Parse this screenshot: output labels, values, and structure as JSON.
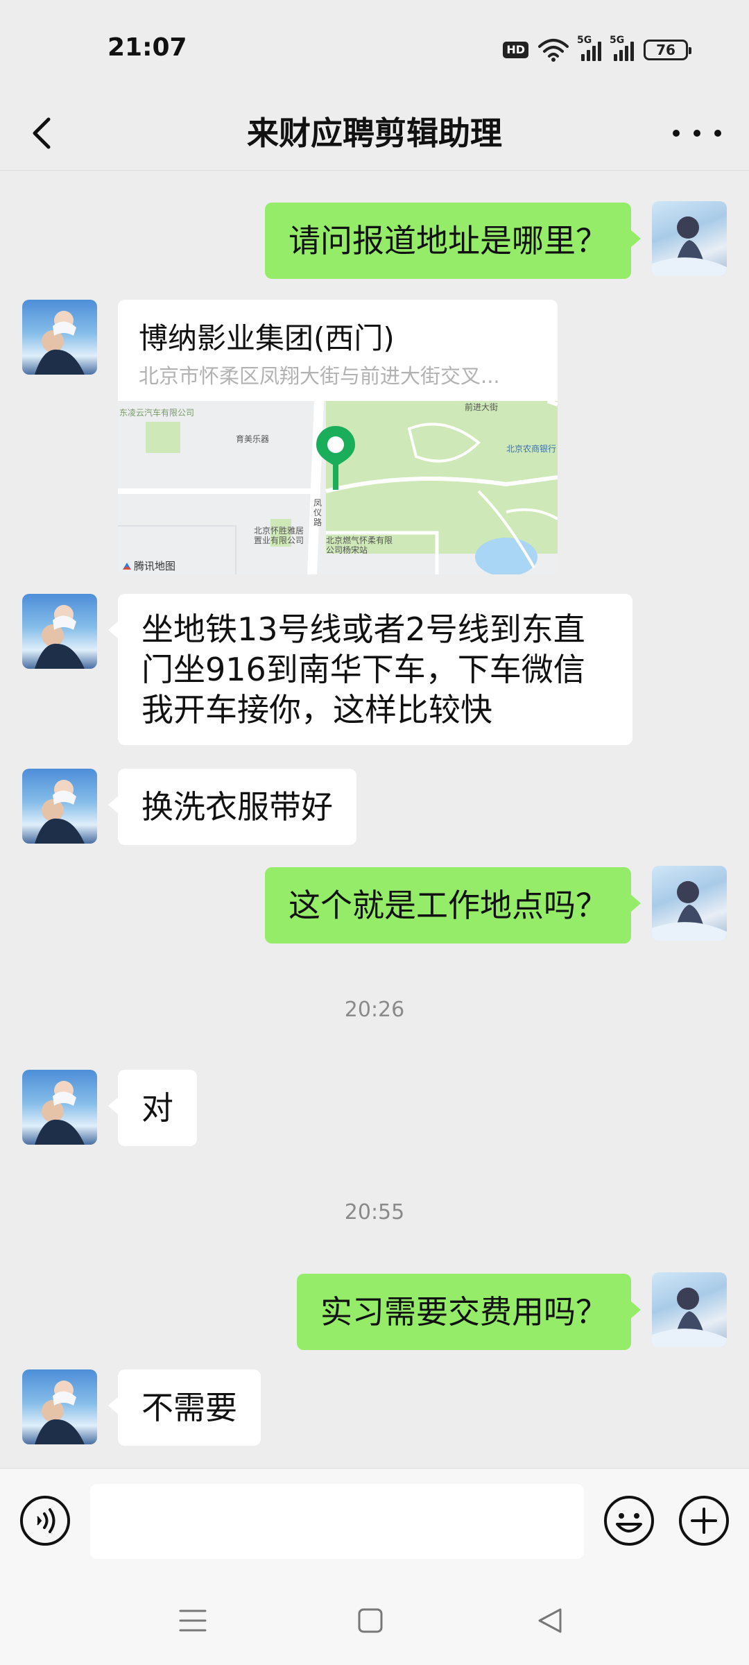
{
  "status_bar": {
    "time": "21:07",
    "hd_label": "HD",
    "network_label_1": "5G",
    "network_label_2": "5G",
    "battery": "76",
    "icons": [
      "hd-icon",
      "wifi-icon",
      "signal-icon",
      "signal-icon",
      "battery-icon"
    ]
  },
  "header": {
    "title": "来财应聘剪辑助理",
    "back_icon": "chevron-left-icon",
    "more_icon": "more-dots-icon"
  },
  "messages": [
    {
      "side": "self",
      "type": "text",
      "text": "请问报道地址是哪里？"
    },
    {
      "side": "other",
      "type": "location",
      "name": "博纳影业集团(西门)",
      "address": "北京市怀柔区凤翔大街与前进大街交叉..."
    },
    {
      "side": "other",
      "type": "text",
      "text": "坐地铁13号线或者2号线到东直门坐916到南华下车，下车微信我开车接你，这样比较快"
    },
    {
      "side": "other",
      "type": "text",
      "text": "换洗衣服带好"
    },
    {
      "side": "self",
      "type": "text",
      "text": "这个就是工作地点吗？"
    },
    {
      "side": "other",
      "type": "text",
      "text": "对"
    },
    {
      "side": "self",
      "type": "text",
      "text": "实习需要交费用吗？"
    },
    {
      "side": "other",
      "type": "text",
      "text": "不需要"
    }
  ],
  "timestamps": [
    "20:26",
    "20:55"
  ],
  "map": {
    "brand": "腾讯地图",
    "labels": {
      "company_1": "东凌云汽车有限公司",
      "store": "育美乐器",
      "bank": "北京农商银行",
      "road_1": "凤仪路",
      "road_2": "前进大街",
      "company_2": "北京怀胜雅居置业有限公司",
      "company_3": "北京燃气怀柔有限公司杨宋站"
    }
  },
  "input_bar": {
    "value": "",
    "voice_icon": "voice-icon",
    "emoji_icon": "emoji-icon",
    "plus_icon": "plus-icon"
  },
  "nav_bar": {
    "icons": [
      "menu-icon",
      "home-square-icon",
      "back-triangle-icon"
    ]
  },
  "colors": {
    "self_bubble": "#95ec69",
    "other_bubble": "#ffffff",
    "background": "#ededed",
    "pin": "#1aad5a"
  }
}
